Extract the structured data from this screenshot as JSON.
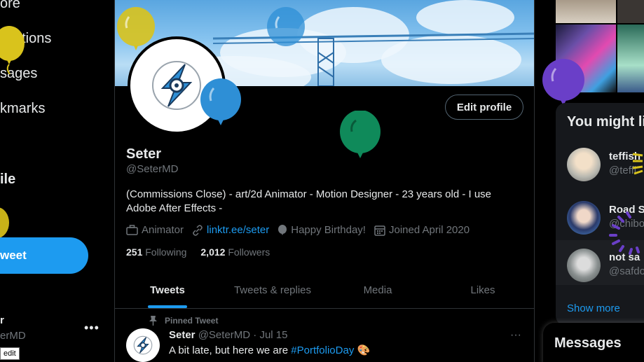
{
  "left_nav": {
    "items": [
      {
        "label": "ore"
      },
      {
        "label": "fications"
      },
      {
        "label": "sages"
      },
      {
        "label": "kmarks"
      },
      {
        "label": "ile"
      }
    ],
    "tweet_button": "weet",
    "account_name": "r",
    "account_handle": "erMD",
    "more": "•••",
    "tooltip": "edit"
  },
  "profile": {
    "edit_button": "Edit profile",
    "name": "Seter",
    "handle": "@SeterMD",
    "bio": "(Commissions Close) - art/2d Animator - Motion Designer - 23 years old - I use Adobe After Effects -",
    "meta": {
      "profession": "Animator",
      "link": "linktr.ee/seter",
      "birthday": "Happy Birthday!",
      "joined": "Joined April 2020"
    },
    "following_count": "251",
    "following_label": "Following",
    "followers_count": "2,012",
    "followers_label": "Followers"
  },
  "tabs": [
    {
      "label": "Tweets"
    },
    {
      "label": "Tweets & replies"
    },
    {
      "label": "Media"
    },
    {
      "label": "Likes"
    }
  ],
  "pinned_tweet": {
    "pinned_label": "Pinned Tweet",
    "author": "Seter",
    "handle": "@SeterMD",
    "date": "· Jul 15",
    "text": "A bit late, but here we are ",
    "hashtag": "#PortfolioDay",
    "emoji": "🎨",
    "more": "···"
  },
  "right": {
    "suggest_title": "You might li",
    "suggestions": [
      {
        "name": "teffish",
        "handle": "@teffi"
      },
      {
        "name": "Road S",
        "handle": "@chibo"
      },
      {
        "name": "not sa",
        "handle": "@safdo"
      }
    ],
    "show_more": "Show more",
    "messages": "Messages"
  },
  "colors": {
    "accent": "#1d9bf0",
    "balloon_yellow": "#d9c31c",
    "balloon_blue": "#2e8fd6",
    "balloon_green": "#0f8a5a",
    "balloon_purple": "#6a3fc8"
  }
}
